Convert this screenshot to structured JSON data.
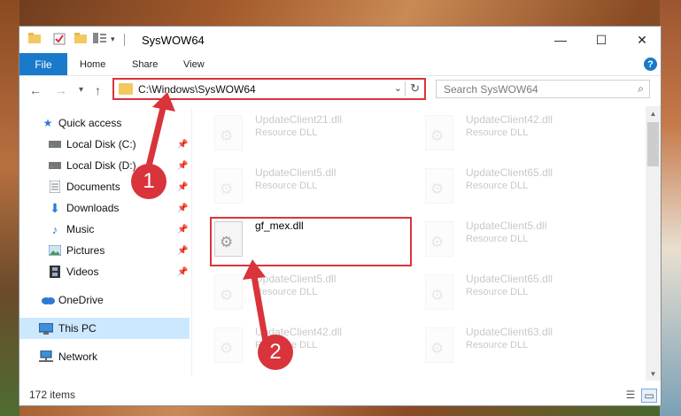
{
  "window": {
    "title": "SysWOW64",
    "controls": {
      "minimize": "—",
      "maximize": "☐",
      "close": "✕"
    }
  },
  "ribbon": {
    "file_tab": "File",
    "tabs": [
      "Home",
      "Share",
      "View"
    ],
    "help": "?"
  },
  "navigation": {
    "back": "←",
    "forward": "→",
    "recent": "▾",
    "up": "↑",
    "address": "C:\\Windows\\SysWOW64",
    "address_dropdown": "⌄",
    "refresh": "↻",
    "search_placeholder": "Search SysWOW64",
    "search_icon": "⌕"
  },
  "sidebar": {
    "quick_access": "Quick access",
    "items": [
      {
        "label": "Local Disk (C:)",
        "pinned": true
      },
      {
        "label": "Local Disk (D:)",
        "pinned": true
      },
      {
        "label": "Documents",
        "pinned": true
      },
      {
        "label": "Downloads",
        "pinned": true
      },
      {
        "label": "Music",
        "pinned": true
      },
      {
        "label": "Pictures",
        "pinned": true
      },
      {
        "label": "Videos",
        "pinned": true
      }
    ],
    "onedrive": "OneDrive",
    "this_pc": "This PC",
    "network": "Network",
    "pin_glyph": "📌"
  },
  "files": {
    "left": [
      {
        "name": "UpdateClient21.dll",
        "type": "Resource DLL"
      },
      {
        "name": "UpdateClient5.dll",
        "type": "Resource DLL"
      },
      {
        "name": "gf_mex.dll",
        "type": ""
      },
      {
        "name": "UpdateClient5.dll",
        "type": "Resource DLL"
      },
      {
        "name": "UpdateClient42.dll",
        "type": "Resource DLL"
      }
    ],
    "right": [
      {
        "name": "UpdateClient42.dll",
        "type": "Resource DLL"
      },
      {
        "name": "UpdateClient65.dll",
        "type": "Resource DLL"
      },
      {
        "name": "UpdateClient5.dll",
        "type": "Resource DLL"
      },
      {
        "name": "UpdateClient65.dll",
        "type": "Resource DLL"
      },
      {
        "name": "UpdateClient63.dll",
        "type": "Resource DLL"
      }
    ]
  },
  "status": {
    "items": "172 items"
  },
  "annotations": {
    "step1": "1",
    "step2": "2"
  },
  "colors": {
    "accent": "#1979ca",
    "highlight": "#d9343b",
    "selected": "#cce8ff"
  }
}
